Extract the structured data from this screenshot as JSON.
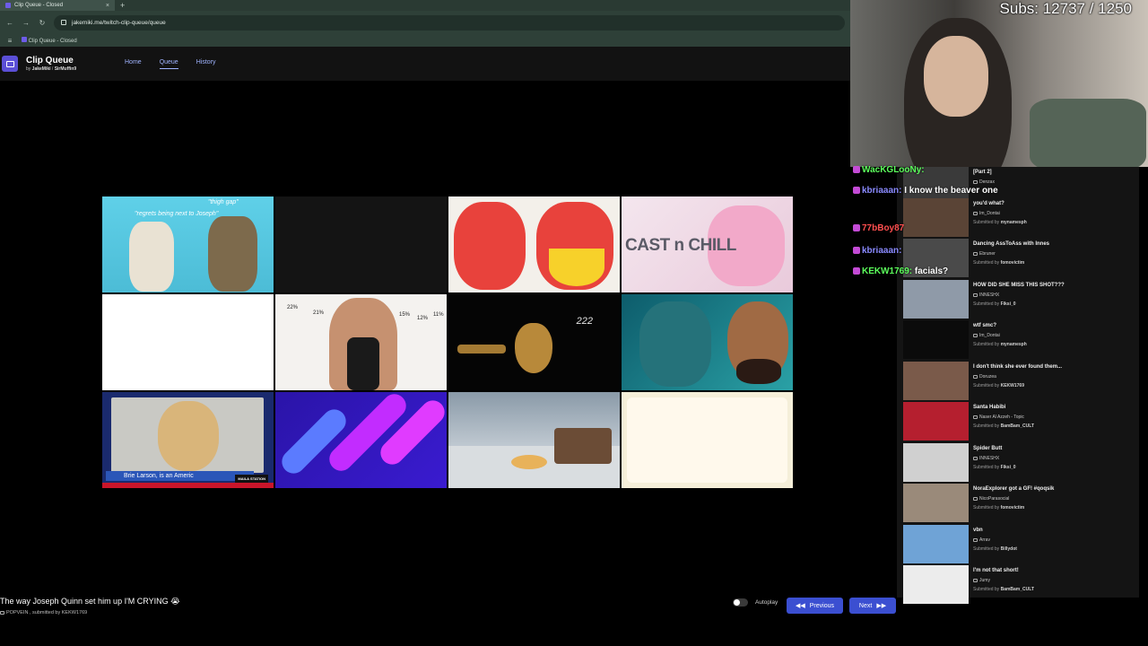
{
  "browser": {
    "tab_title": "Clip Queue - Closed",
    "new_tab_glyph": "+",
    "close_glyph": "×",
    "url": "jakemiki.me/twitch-clip-queue/queue",
    "bookmark": "Clip Queue - Closed"
  },
  "app": {
    "title": "Clip Queue",
    "by": "by",
    "author1": "JakeMiki",
    "separator": "/",
    "author2": "SirMuffin9",
    "nav": [
      "Home",
      "Queue",
      "History"
    ],
    "active_nav": "Queue"
  },
  "grid_thumbnails": [
    {
      "name": "thumb-regrets",
      "texts": [
        "\"regrets being next to Joseph\"",
        "\"thigh gap\""
      ]
    },
    {
      "name": "thumb-dark-scene"
    },
    {
      "name": "thumb-cartoon-umbrella"
    },
    {
      "name": "thumb-cast-n-chill",
      "text": "CAST n CHILL"
    },
    {
      "name": "thumb-blank-white"
    },
    {
      "name": "thumb-body-fat",
      "texts": [
        "22%",
        "21%",
        "15%",
        "12%",
        "11%"
      ]
    },
    {
      "name": "thumb-lock-key",
      "text": "222"
    },
    {
      "name": "thumb-mermaid-reaction"
    },
    {
      "name": "thumb-brie-larson",
      "text": "Brie Larson, is an Americ",
      "tag": "MAILA STATION"
    },
    {
      "name": "thumb-purple-stripes"
    },
    {
      "name": "thumb-snow-village"
    },
    {
      "name": "thumb-cream-frame"
    }
  ],
  "player": {
    "now_playing": "The way Joseph Quinn set him up I'M CRYING",
    "channel": "POPVEIN",
    "submitted_by_label": "submitted by",
    "submitter": "KEKW1769",
    "autoplay_label": "Autoplay",
    "previous_label": "Previous",
    "next_label": "Next"
  },
  "stream": {
    "subs": "Subs: 12737 / 1250"
  },
  "chat": [
    {
      "user": "WacKGLooNy:",
      "msg": "",
      "color": "#5cff5c"
    },
    {
      "user": "kbriaaan:",
      "msg": "I know the beaver one",
      "color": "#8a8aff"
    },
    {
      "user": "77bBoy87",
      "msg": "",
      "color": "#ff4f4f"
    },
    {
      "user": "kbriaaan:",
      "msg": "",
      "color": "#8a8aff"
    },
    {
      "user": "KEKW1769:",
      "msg": "facials?",
      "color": "#5cff5c"
    }
  ],
  "queue": [
    {
      "title": "[Part 2]",
      "channel": "Denzax",
      "submitter": "",
      "color": "#3a3a3a"
    },
    {
      "title": "you'd what?",
      "channel": "Im_Dontai",
      "submitter": "mynamesph",
      "color": "#5a4436"
    },
    {
      "title": "Dancing AssToAss with Innes",
      "channel": "Ebruner",
      "submitter": "fomovictim",
      "color": "#4a4a4a"
    },
    {
      "title": "HOW DID SHE MISS THIS SHOT???",
      "channel": "INNESHX",
      "submitter": "Fiksi_0",
      "color": "#8f9aa8"
    },
    {
      "title": "wtf smc?",
      "channel": "Im_Dontai",
      "submitter": "mynamesph",
      "color": "#0b0b0b"
    },
    {
      "title": "I don't think she ever found them...",
      "channel": "Doruzea",
      "submitter": "KEKW1769",
      "color": "#7a5a4a"
    },
    {
      "title": "Santa Habibi",
      "channel": "Naser Al Azzeh - Topic",
      "submitter": "BamBam_CULT",
      "color": "#b51f2f"
    },
    {
      "title": "Spider Butt",
      "channel": "INNESHX",
      "submitter": "Fiksi_0",
      "color": "#d0d0d0"
    },
    {
      "title": "NoraExplorer got a GF! #qoqsik",
      "channel": "NicoParasocial",
      "submitter": "fomovictim",
      "color": "#9a8a7a"
    },
    {
      "title": "vbn",
      "channel": "Arrav",
      "submitter": "Billydot",
      "color": "#6fa3d6"
    },
    {
      "title": "I'm not that short!",
      "channel": "Jumy",
      "submitter": "BamBam_CULT",
      "color": "#ececec"
    }
  ],
  "queue_labels": {
    "submitted_by": "Submitted by"
  },
  "colors": {
    "accent": "#3b4fd1",
    "logo": "#5b4fd6",
    "nav_link": "#a0b4ff"
  }
}
